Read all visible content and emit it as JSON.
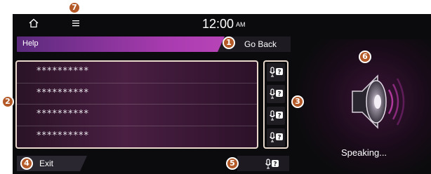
{
  "status_bar": {
    "time": "12:00",
    "ampm": "AM",
    "home_icon": "home-icon",
    "menu_icon": "hamburger-menu-icon"
  },
  "header": {
    "title": "Help",
    "go_back_label": "Go Back"
  },
  "commands": [
    {
      "text": "**********"
    },
    {
      "text": "**********"
    },
    {
      "text": "**********"
    },
    {
      "text": "**********"
    }
  ],
  "voice_buttons": {
    "icon": "voice-help-icon",
    "count": 4
  },
  "footer": {
    "exit_label": "Exit",
    "voice_help_icon": "voice-help-icon"
  },
  "right_panel": {
    "status_text": "Speaking...",
    "icon": "speaker-icon"
  },
  "callouts": [
    "7",
    "1",
    "2",
    "3",
    "4",
    "5",
    "6"
  ],
  "colors": {
    "badge": "#b45a28",
    "header_gradient_start": "#5a2a7c",
    "header_gradient_end": "#c84fc0",
    "list_border": "#e8d9cc",
    "background": "#0b0b0d"
  }
}
